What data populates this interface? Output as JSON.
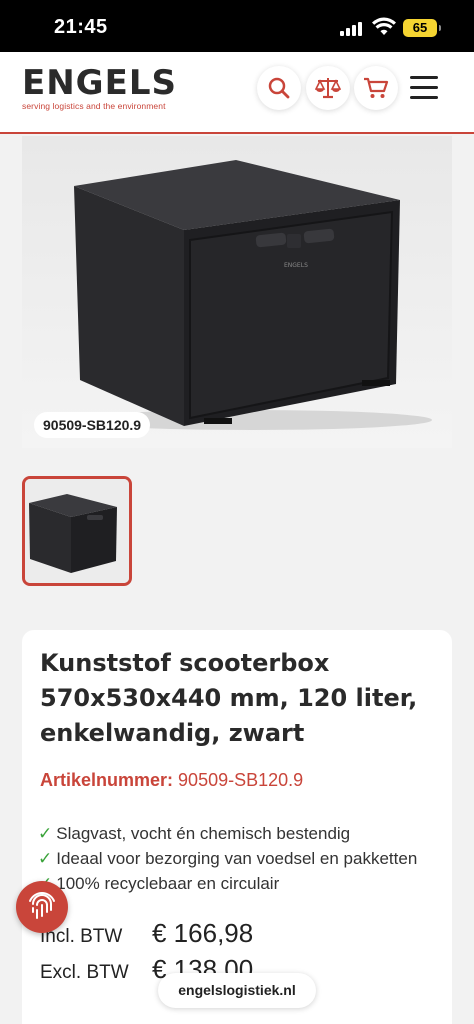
{
  "status_bar": {
    "time": "21:45",
    "battery": "65"
  },
  "header": {
    "logo_text": "ENGELS",
    "logo_tagline": "serving logistics and the environment",
    "icons": [
      "search-icon",
      "compare-scale-icon",
      "cart-icon",
      "menu-icon"
    ]
  },
  "product": {
    "image_sku": "90509-SB120.9",
    "title": "Kunststof scooterbox 570x530x440 mm, 120 liter, enkelwandig, zwart",
    "artikel_label": "Artikelnummer:",
    "artikel_value": "90509-SB120.9",
    "usps": [
      "Slagvast, vocht én chemisch bestendig",
      "Ideaal voor bezorging van voedsel en pakketten",
      "100% recyclebaar en circulair"
    ],
    "check_mark": "✓",
    "incl_label": "Incl. BTW",
    "incl_price": "€ 166,98",
    "excl_label": "Excl. BTW",
    "excl_price": "€ 138,00"
  },
  "browser": {
    "url": "engelslogistiek.nl"
  },
  "colors": {
    "accent": "#c9453a",
    "check": "#3aa33a"
  }
}
